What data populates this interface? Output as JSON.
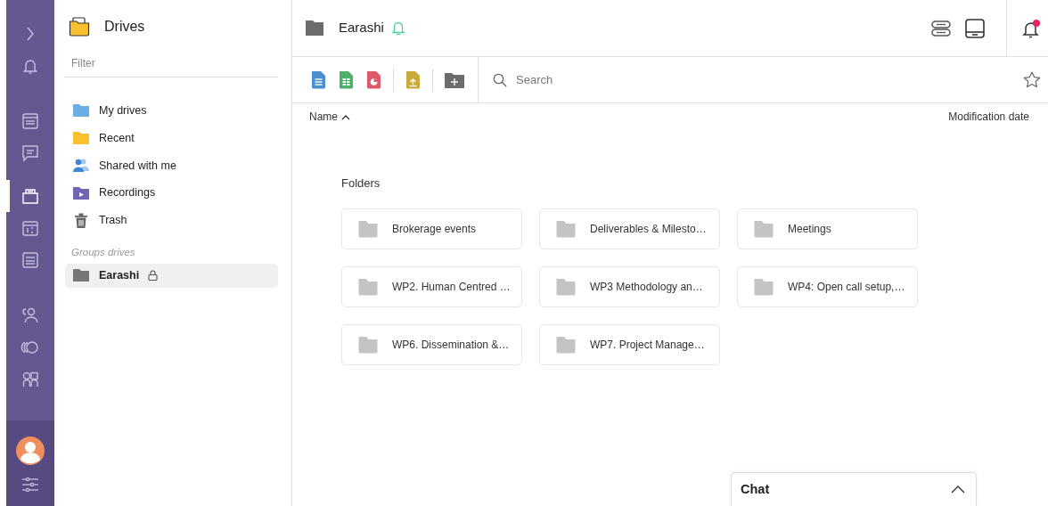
{
  "rail": {
    "items": [
      {
        "kind": "expand",
        "selected": false
      },
      {
        "kind": "bell",
        "selected": false
      },
      {
        "kind": "news",
        "selected": false
      },
      {
        "kind": "chat",
        "selected": false
      },
      {
        "kind": "drives",
        "selected": true
      },
      {
        "kind": "calendar",
        "selected": false
      },
      {
        "kind": "list",
        "selected": false
      },
      {
        "kind": "people",
        "selected": false
      },
      {
        "kind": "circles",
        "selected": false
      },
      {
        "kind": "apps",
        "selected": false
      }
    ],
    "bottom": [
      {
        "kind": "avatar"
      },
      {
        "kind": "settings"
      }
    ]
  },
  "sidebar": {
    "title": "Drives",
    "filter": {
      "placeholder": "Filter"
    },
    "items": [
      {
        "label": "My drives",
        "kind": "blue-folder"
      },
      {
        "label": "Recent",
        "kind": "yellow-folder"
      },
      {
        "label": "Shared with me",
        "kind": "people"
      },
      {
        "label": "Recordings",
        "kind": "recordings"
      },
      {
        "label": "Trash",
        "kind": "trash"
      }
    ],
    "groups_label": "Groups drives",
    "groups": [
      {
        "label": "Earashi",
        "locked": true,
        "selected": true
      }
    ]
  },
  "header": {
    "title": "Earashi",
    "subscribed": true,
    "notification_badge": true
  },
  "toolbar": {
    "buttons": [
      {
        "kind": "doc"
      },
      {
        "kind": "sheet"
      },
      {
        "kind": "slides"
      },
      {
        "kind": "upload"
      },
      {
        "kind": "new-folder"
      }
    ],
    "search": {
      "placeholder": "Search"
    },
    "favorite": false
  },
  "table": {
    "columns": [
      {
        "label": "Name",
        "sorted": true
      },
      {
        "label": "Modification date",
        "sorted": false
      }
    ]
  },
  "section_title": "Folders",
  "folders": [
    {
      "name": "Brokerage events"
    },
    {
      "name": "Deliverables & Milesto…"
    },
    {
      "name": "Meetings"
    },
    {
      "name": "WP2. Human Centred …"
    },
    {
      "name": "WP3 Methodology an…"
    },
    {
      "name": "WP4: Open call setup,…"
    },
    {
      "name": "WP6. Dissemination &…"
    },
    {
      "name": "WP7. Project Manage…"
    }
  ],
  "chat": {
    "title": "Chat",
    "expanded": false
  }
}
